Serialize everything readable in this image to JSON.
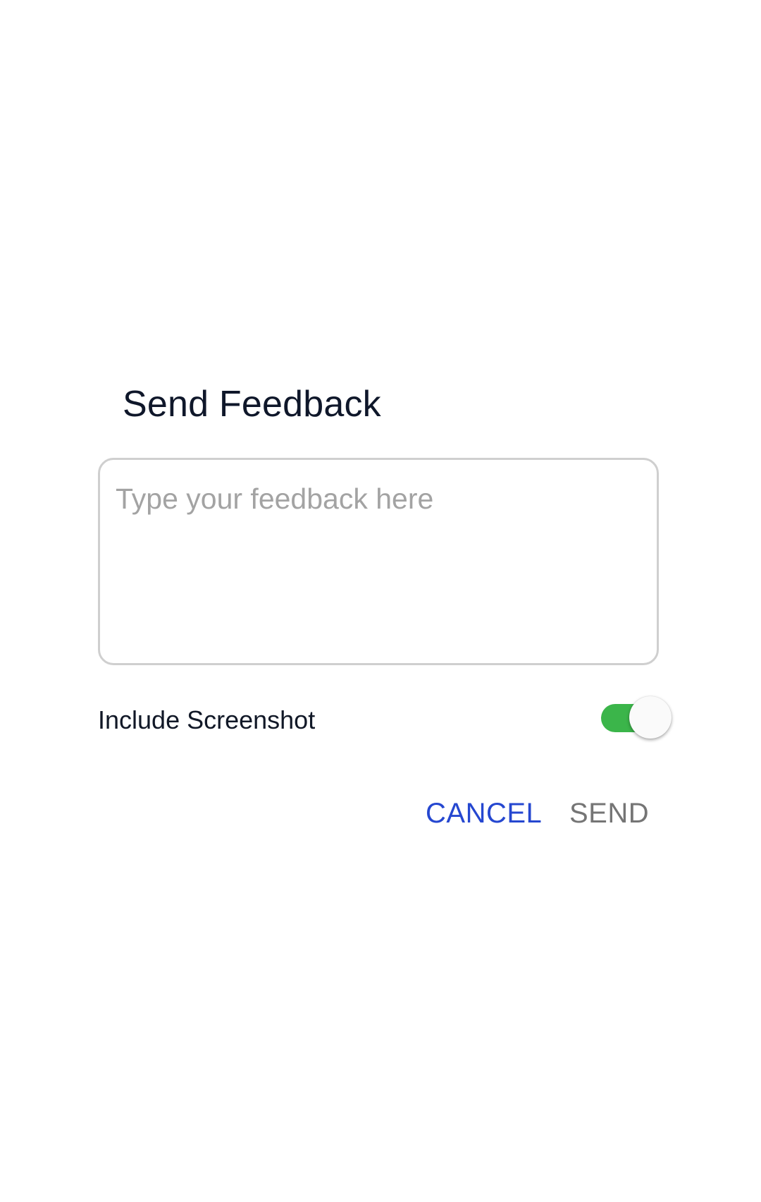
{
  "dialog": {
    "title": "Send Feedback",
    "feedback_input": {
      "value": "",
      "placeholder": "Type your feedback here"
    },
    "include_screenshot": {
      "label": "Include Screenshot",
      "enabled": true,
      "track_color": "#3bb54a"
    },
    "actions": {
      "cancel_label": "CANCEL",
      "send_label": "SEND",
      "cancel_color": "#2547d0",
      "send_color": "#757575"
    }
  }
}
